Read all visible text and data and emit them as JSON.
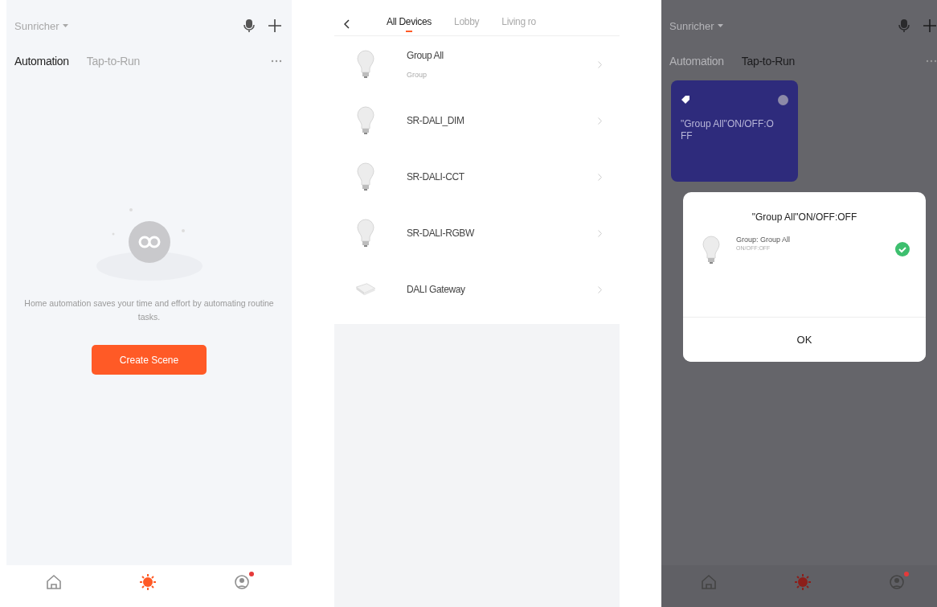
{
  "screens": [
    {
      "kind": "scenes",
      "home_name": "Sunricher",
      "dimmed": false,
      "tabs": [
        {
          "label": "Automation",
          "selected": true
        },
        {
          "label": "Tap-to-Run",
          "selected": false
        }
      ],
      "empty_state": {
        "description": "Home automation saves your time and effort by automating routine tasks.",
        "button": "Create Scene"
      },
      "bottom_nav": [
        {
          "selected": false
        },
        {
          "selected": true
        },
        {
          "selected": false,
          "badge": true
        }
      ]
    },
    {
      "kind": "devices",
      "tabs": [
        {
          "label": "All Devices",
          "selected": true
        },
        {
          "label": "Lobby",
          "selected": false
        },
        {
          "label": "Living ro",
          "selected": false
        }
      ],
      "devices": [
        {
          "name": "Group All",
          "subtitle": "Group",
          "kind": "bulb"
        },
        {
          "name": "SR-DALI_DIM",
          "kind": "bulb"
        },
        {
          "name": "SR-DALI-CCT",
          "kind": "bulb"
        },
        {
          "name": "SR-DALI-RGBW",
          "kind": "bulb"
        },
        {
          "name": "DALI Gateway",
          "kind": "gateway"
        }
      ]
    },
    {
      "kind": "scenes",
      "home_name": "Sunricher",
      "dimmed": true,
      "tabs": [
        {
          "label": "Automation",
          "selected": false
        },
        {
          "label": "Tap-to-Run",
          "selected": true
        }
      ],
      "scene_cards": [
        {
          "title": "\"Group All\"ON/OFF:OFF"
        }
      ],
      "dialog": {
        "title": "\"Group All\"ON/OFF:OFF",
        "items": [
          {
            "name": "Group: Group All",
            "detail": "ON/OFF:OFF",
            "checked": true
          }
        ],
        "button": "OK"
      },
      "bottom_nav": [
        {
          "selected": false
        },
        {
          "selected": true
        },
        {
          "selected": false,
          "badge": true
        }
      ]
    }
  ]
}
